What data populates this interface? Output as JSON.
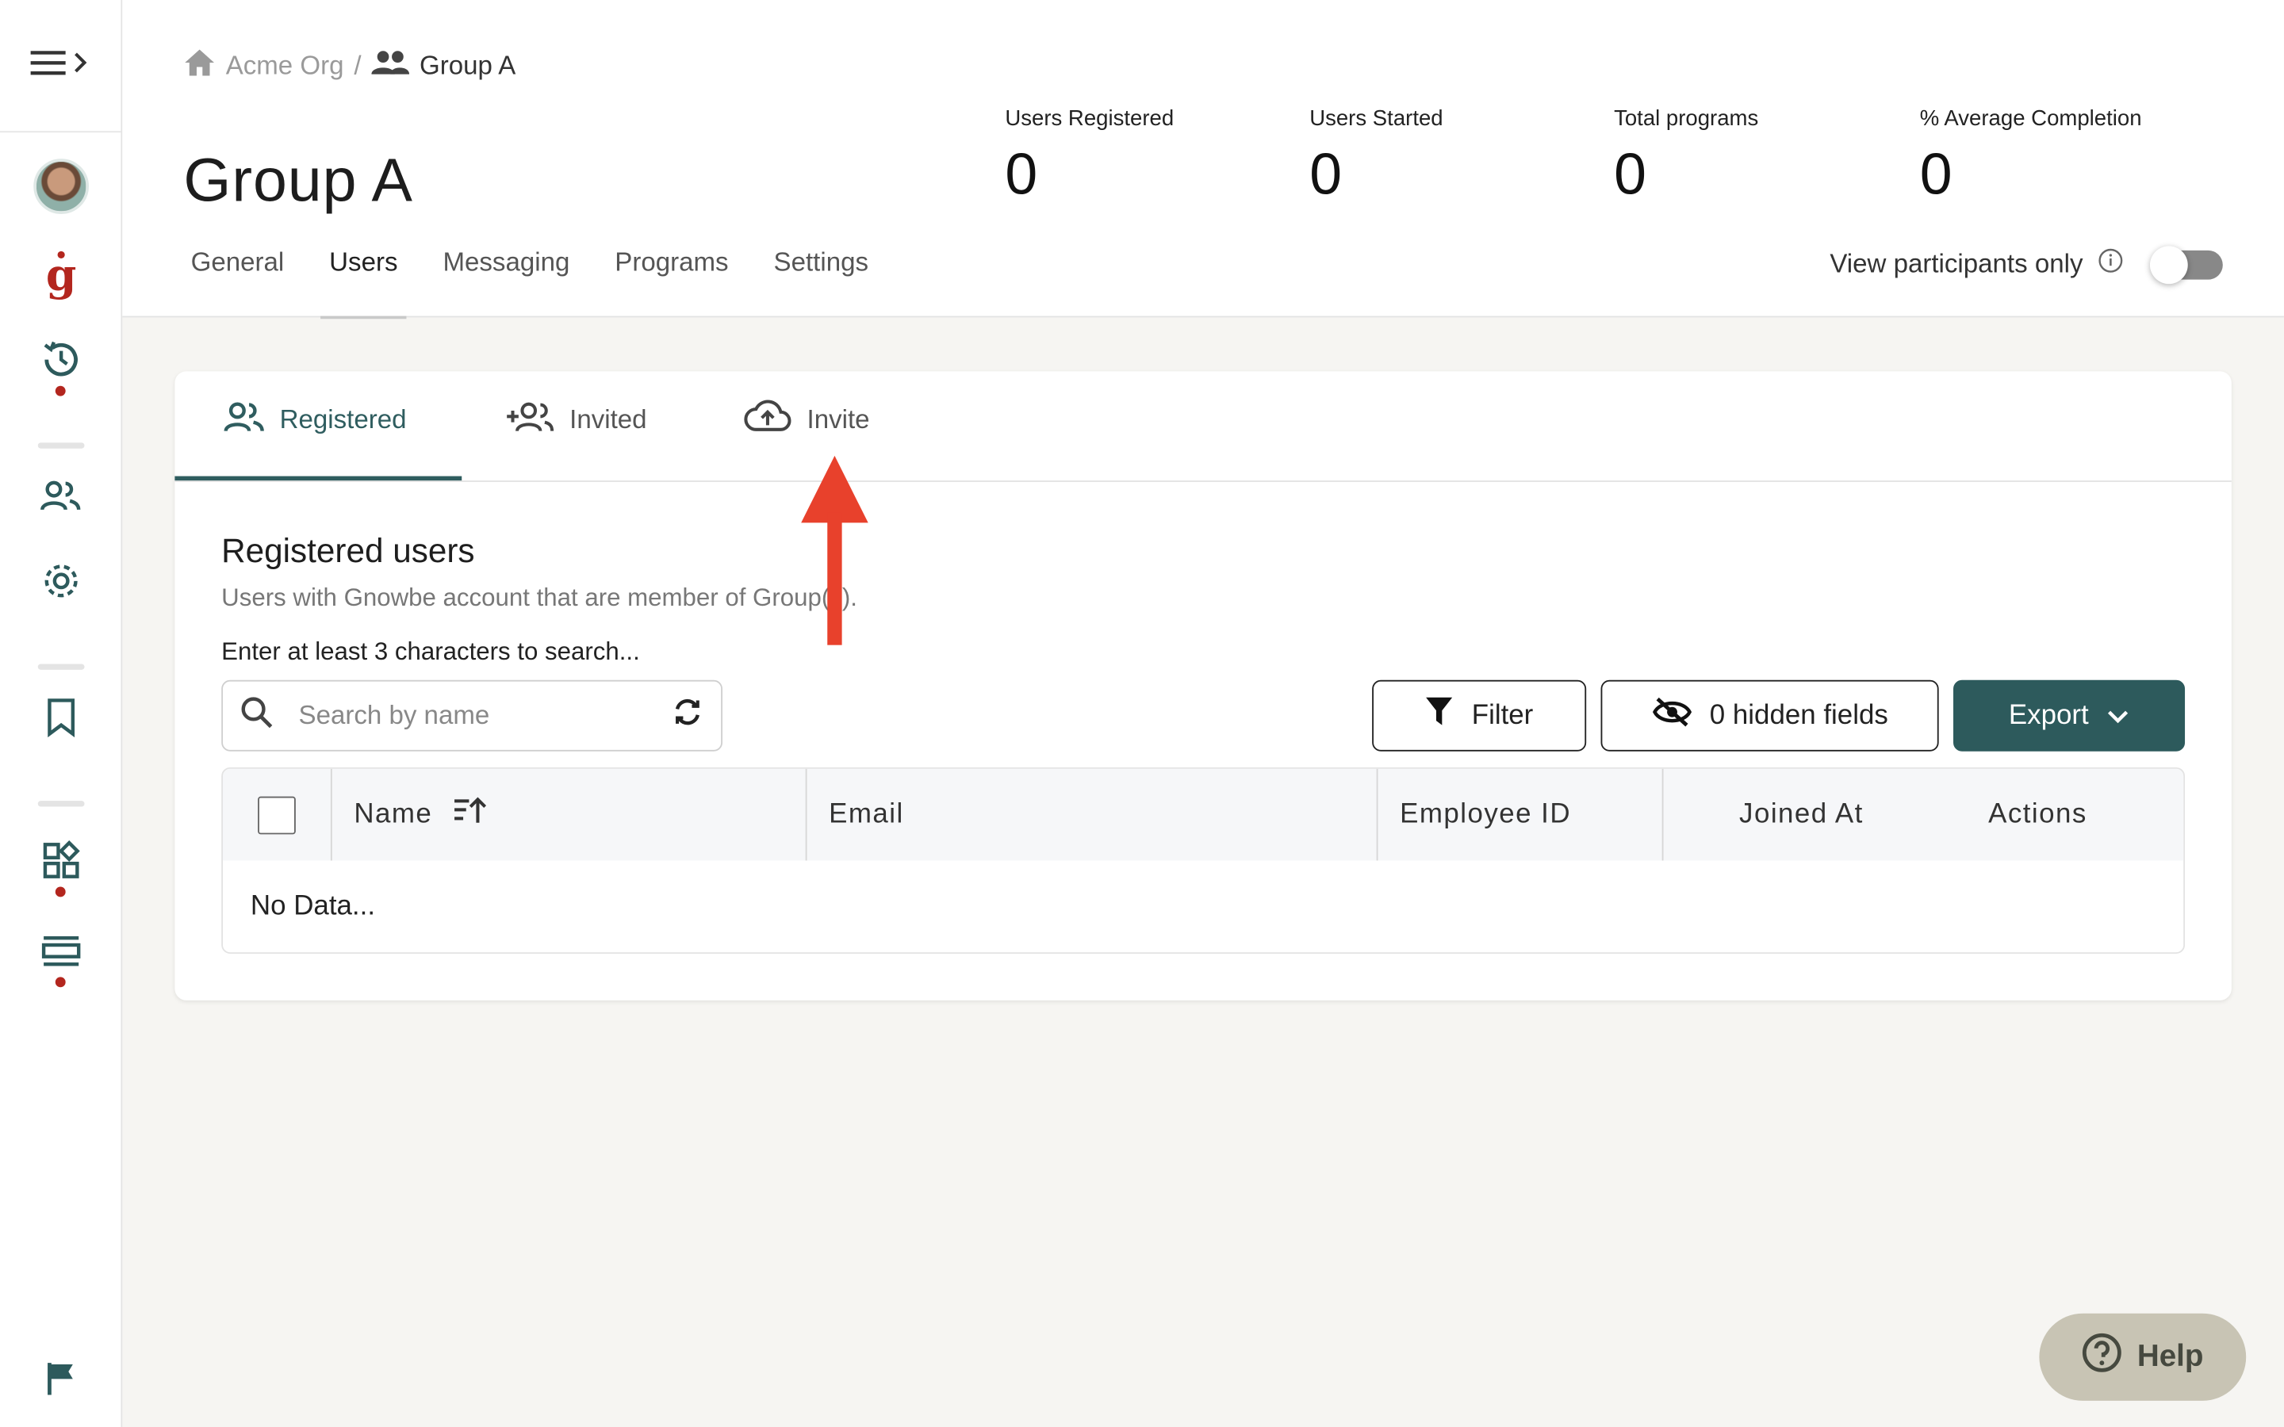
{
  "breadcrumb": {
    "org": "Acme Org",
    "separator": "/",
    "group": "Group A"
  },
  "page": {
    "title": "Group A"
  },
  "stats": [
    {
      "label": "Users Registered",
      "value": "0"
    },
    {
      "label": "Users Started",
      "value": "0"
    },
    {
      "label": "Total programs",
      "value": "0"
    },
    {
      "label": "% Average Completion",
      "value": "0"
    }
  ],
  "tabs": [
    {
      "label": "General"
    },
    {
      "label": "Users"
    },
    {
      "label": "Messaging"
    },
    {
      "label": "Programs"
    },
    {
      "label": "Settings"
    }
  ],
  "active_tab": "Users",
  "view_participants": {
    "label": "View participants only",
    "enabled": false
  },
  "subtabs": [
    {
      "label": "Registered"
    },
    {
      "label": "Invited"
    },
    {
      "label": "Invite"
    }
  ],
  "section": {
    "title": "Registered users",
    "subtitle": "Users with Gnowbe account that are member of Group(s).",
    "hint": "Enter at least 3 characters to search..."
  },
  "search": {
    "placeholder": "Search by name",
    "value": ""
  },
  "buttons": {
    "filter": "Filter",
    "hidden_fields": "0 hidden fields",
    "export": "Export"
  },
  "table": {
    "columns": [
      "Name",
      "Email",
      "Employee ID",
      "Joined At",
      "Actions"
    ],
    "empty_text": "No Data..."
  },
  "help": {
    "label": "Help"
  },
  "colors": {
    "accent": "#2d5a5c",
    "brand_red": "#b3261e",
    "arrow": "#e8412c",
    "help_bg": "#c8c4b4"
  }
}
